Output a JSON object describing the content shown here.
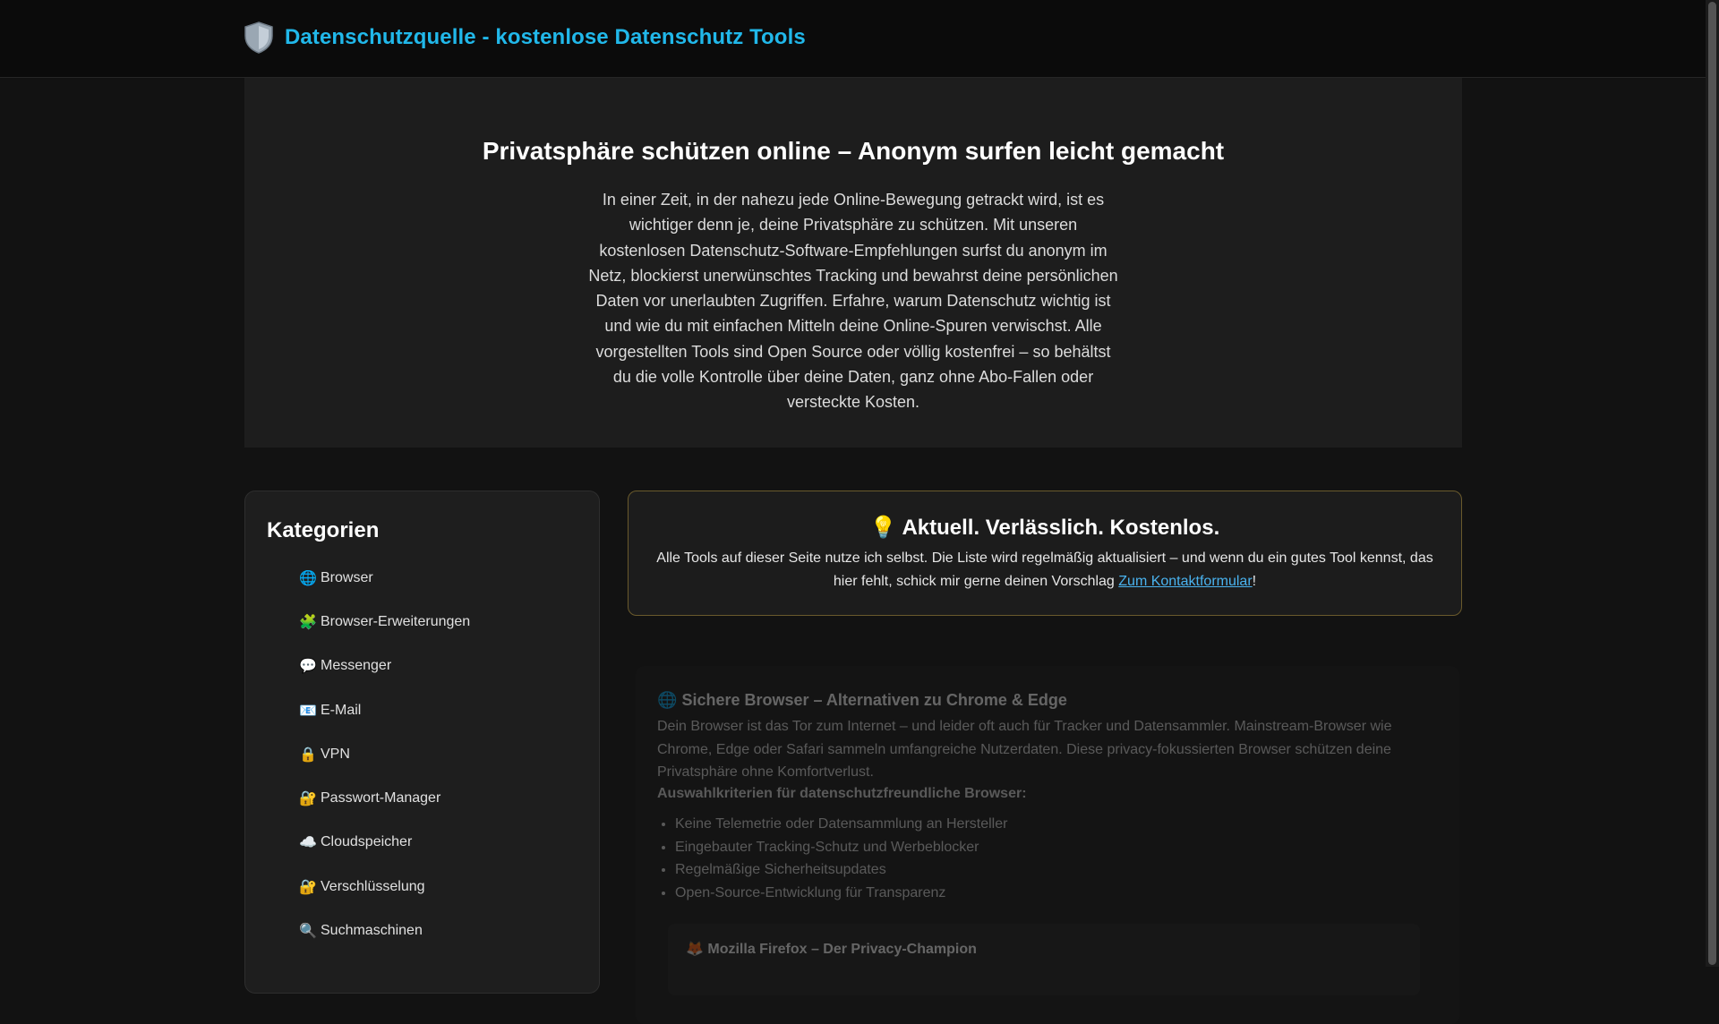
{
  "header": {
    "title": "Datenschutzquelle - kostenlose Datenschutz Tools",
    "logo_icon": "shield-icon"
  },
  "hero": {
    "heading": "Privatsphäre schützen online – Anonym surfen leicht gemacht",
    "text": "In einer Zeit, in der nahezu jede Online-Bewegung getrackt wird, ist es wichtiger denn je, deine Privatsphäre zu schützen. Mit unseren kostenlosen Datenschutz-Software-Empfehlungen surfst du anonym im Netz, blockierst unerwünschtes Tracking und bewahrst deine persönlichen Daten vor unerlaubten Zugriffen. Erfahre, warum Datenschutz wichtig ist und wie du mit einfachen Mitteln deine Online-Spuren verwischst. Alle vorgestellten Tools sind Open Source oder völlig kostenfrei – so behältst du die volle Kontrolle über deine Daten, ganz ohne Abo-Fallen oder versteckte Kosten."
  },
  "sidebar": {
    "heading": "Kategorien",
    "items": [
      {
        "icon": "🌐",
        "label": "Browser"
      },
      {
        "icon": "🧩",
        "label": "Browser-Erweiterungen"
      },
      {
        "icon": "💬",
        "label": "Messenger"
      },
      {
        "icon": "📧",
        "label": "E-Mail"
      },
      {
        "icon": "🔒",
        "label": "VPN"
      },
      {
        "icon": "🔐",
        "label": "Passwort-Manager"
      },
      {
        "icon": "☁️",
        "label": "Cloudspeicher"
      },
      {
        "icon": "🔐",
        "label": "Verschlüsselung"
      },
      {
        "icon": "🔍",
        "label": "Suchmaschinen"
      }
    ]
  },
  "notice": {
    "icon": "💡",
    "heading": "Aktuell. Verlässlich. Kostenlos.",
    "text_before": "Alle Tools auf dieser Seite nutze ich selbst. Die Liste wird regelmäßig aktualisiert – und wenn du ein gutes Tool kennst, das hier fehlt, schick mir gerne deinen Vorschlag ",
    "link_label": "Zum Kontaktformular",
    "text_after": "!"
  },
  "section": {
    "icon": "🌐",
    "heading": "Sichere Browser – Alternativen zu Chrome & Edge",
    "intro": "Dein Browser ist das Tor zum Internet – und leider oft auch für Tracker und Datensammler. Mainstream-Browser wie Chrome, Edge oder Safari sammeln umfangreiche Nutzerdaten. Diese privacy-fokussierten Browser schützen deine Privatsphäre ohne Komfortverlust.",
    "criteria_heading": "Auswahlkriterien für datenschutzfreundliche Browser:",
    "criteria": [
      "Keine Telemetrie oder Datensammlung an Hersteller",
      "Eingebauter Tracking-Schutz und Werbeblocker",
      "Regelmäßige Sicherheitsupdates",
      "Open-Source-Entwicklung für Transparenz"
    ],
    "card_icon": "🦊",
    "card_title": "Mozilla Firefox – Der Privacy-Champion"
  }
}
